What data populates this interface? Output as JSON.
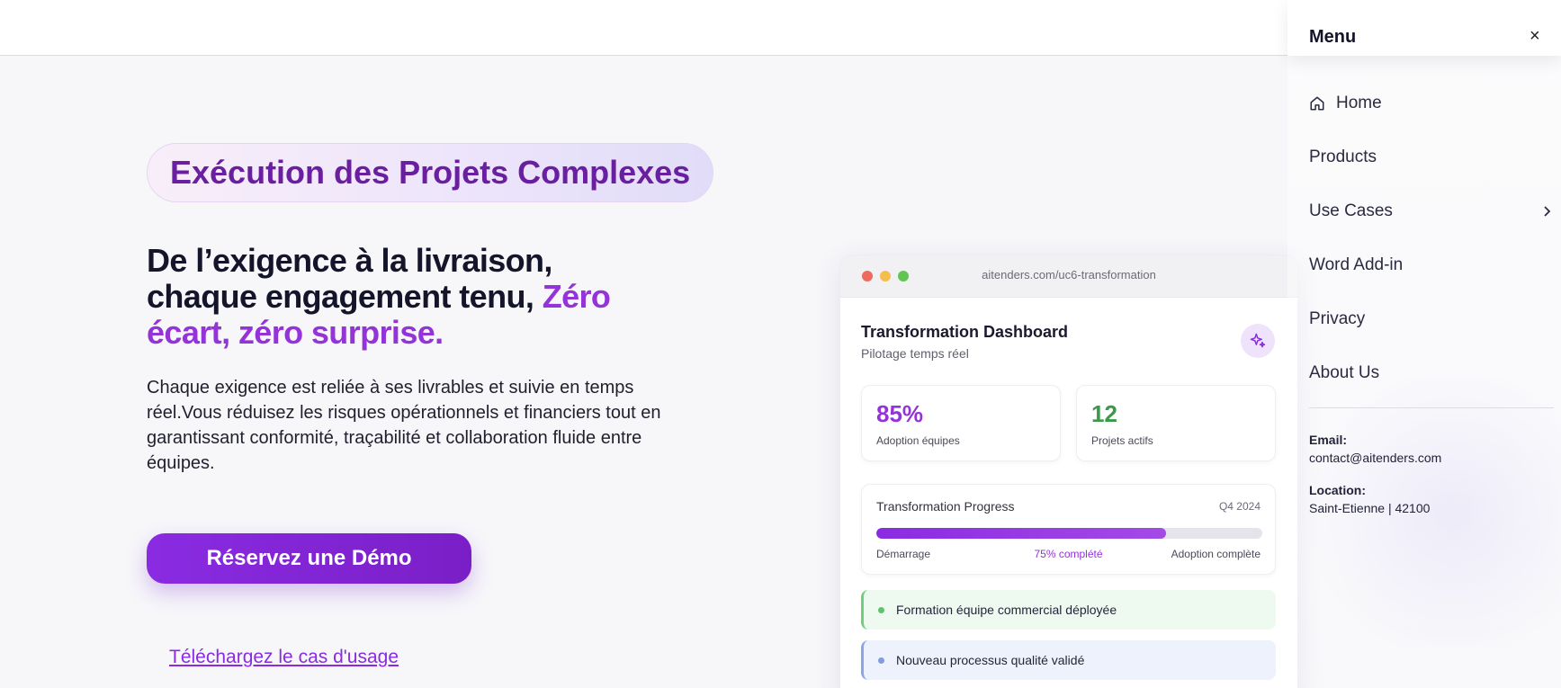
{
  "hero": {
    "badge": "Exécution des Projets Complexes",
    "headline_line1": "De l’exigence à la livraison,",
    "headline_line2_plain": "chaque engagement tenu, ",
    "headline_line2_accent": "Zéro",
    "headline_line3_accent": "écart, zéro surprise.",
    "paragraph": "Chaque exigence est reliée à ses livrables et suivie en temps réel.Vous réduisez les risques opérationnels et financiers tout en garantissant conformité, traçabilité et collaboration fluide entre équipes.",
    "cta_label": "Réservez une Démo",
    "usecase_link": "Téléchargez le cas d'usage"
  },
  "dashboard": {
    "url": "aitenders.com/uc6-transformation",
    "title": "Transformation Dashboard",
    "subtitle": "Pilotage temps réel",
    "stats": [
      {
        "value": "85%",
        "label": "Adoption équipes"
      },
      {
        "value": "12",
        "label": "Projets actifs"
      }
    ],
    "progress": {
      "title": "Transformation Progress",
      "quarter": "Q4 2024",
      "fraction": 0.75,
      "start_label": "Démarrage",
      "mid_label": "75% complété",
      "end_label": "Adoption complète"
    },
    "activities": [
      {
        "text": "Formation équipe commercial déployée"
      },
      {
        "text": "Nouveau processus qualité validé"
      }
    ]
  },
  "menu": {
    "title": "Menu",
    "close": "×",
    "items": [
      {
        "label": "Home"
      },
      {
        "label": "Products"
      },
      {
        "label": "Use Cases"
      },
      {
        "label": "Word Add-in"
      },
      {
        "label": "Privacy"
      },
      {
        "label": "About Us"
      }
    ],
    "email_label": "Email:",
    "email": "contact@aitenders.com",
    "location_label": "Location:",
    "location": "Saint-Etienne | 42100"
  },
  "colors": {
    "accent": "#8a2be2",
    "accent_text": "#9333d8",
    "green": "#3a9a4a"
  }
}
